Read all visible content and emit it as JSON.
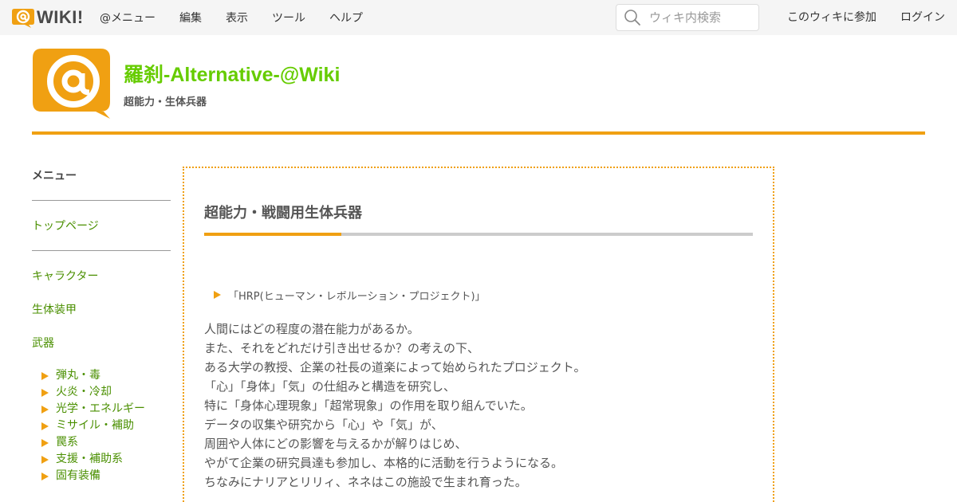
{
  "topbar": {
    "logo_text": "WIKI!",
    "nav": [
      "@メニュー",
      "編集",
      "表示",
      "ツール",
      "ヘルプ"
    ],
    "search_placeholder": "ウィキ内検索",
    "join_label": "このウィキに参加",
    "login_label": "ログイン"
  },
  "header": {
    "title": "羅刹-Alternative-@Wiki",
    "subtitle": "超能力・生体兵器"
  },
  "sidebar": {
    "menu_title": "メニュー",
    "top_link": "トップページ",
    "links": [
      "キャラクター",
      "生体装甲",
      "武器"
    ],
    "subitems": [
      "弾丸・毒",
      "火炎・冷却",
      "光学・エネルギー",
      "ミサイル・補助",
      "罠系",
      "支援・補助系",
      "固有装備"
    ]
  },
  "content": {
    "title": "超能力・戦闘用生体兵器",
    "toggle_label": "「HRP(ヒューマン・レボルーション・プロジェクト)」",
    "paragraph_lines": [
      "人間にはどの程度の潜在能力があるか。",
      "また、それをどれだけ引き出せるか？の考えの下、",
      "ある大学の教授、企業の社長の道楽によって始められたプロジェクト。",
      "「心」「身体」「気」の仕組みと構造を研究し、",
      "特に「身体心理現象」「超常現象」の作用を取り組んでいた。",
      "データの収集や研究から「心」や「気」が、",
      "周囲や人体にどの影響を与えるかが解りはじめ、",
      "やがて企業の研究員達も参加し、本格的に活動を行うようになる。",
      "ちなみにナリアとリリィ、ネネはこの施設で生まれ育った。"
    ]
  },
  "colors": {
    "accent": "#f0a012",
    "link": "#4a8f00",
    "title_green": "#66cc00"
  },
  "icons": {
    "logo": "at-sign-icon",
    "search": "search-icon",
    "site_logo": "at-speech-bubble-icon",
    "bullet": "triangle-right-icon"
  }
}
